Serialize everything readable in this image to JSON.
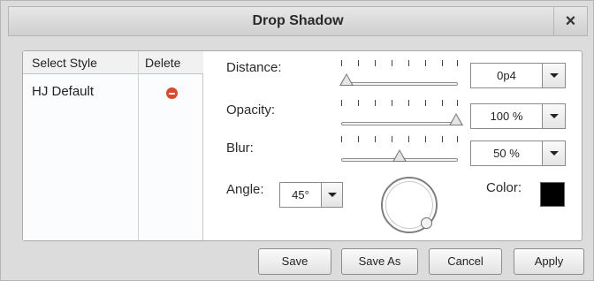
{
  "dialog": {
    "title": "Drop Shadow",
    "close_label": "×"
  },
  "style_panel": {
    "col_select_style": "Select Style",
    "col_delete": "Delete",
    "items": [
      {
        "name": "HJ Default",
        "delete_icon": "minus-circle-icon",
        "delete_color": "#e0462a"
      }
    ]
  },
  "settings": {
    "distance": {
      "label": "Distance:",
      "value": "0p4",
      "slider_fraction": 0.05
    },
    "opacity": {
      "label": "Opacity:",
      "value": "100 %",
      "slider_fraction": 1.0
    },
    "blur": {
      "label": "Blur:",
      "value": "50 %",
      "slider_fraction": 0.5
    },
    "angle": {
      "label": "Angle:",
      "value": "45°"
    },
    "color": {
      "label": "Color:",
      "swatch": "#000000"
    }
  },
  "buttons": {
    "save": "Save",
    "save_as": "Save As",
    "cancel": "Cancel",
    "apply": "Apply"
  }
}
